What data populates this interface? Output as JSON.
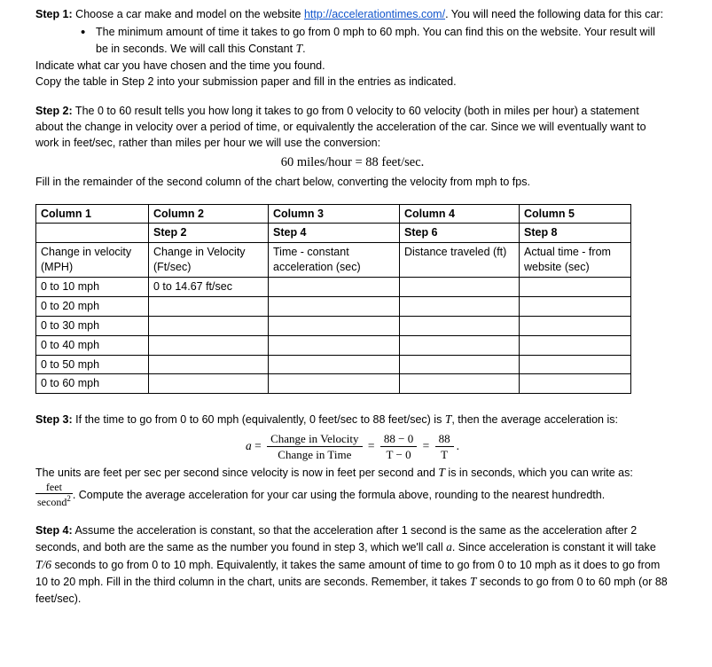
{
  "step1": {
    "label": "Step 1:",
    "text_before_link": " Choose a car make and model on the website ",
    "link": "http://accelerationtimes.com/",
    "text_after_link": ". You will need the following data for this car:",
    "bullet": "The minimum amount of time it takes to go from 0 mph to 60 mph. You can find this on the website. Your result will be in seconds. We will call this Constant ",
    "bullet_symbol": "T",
    "bullet_end": ".",
    "line2": "Indicate what car you have chosen and the time you found.",
    "line3": "Copy the table in Step 2 into your submission paper and fill in the entries as indicated."
  },
  "step2": {
    "label": "Step 2:",
    "text": " The 0 to 60 result tells you how long it takes to go from 0 velocity to 60 velocity (both in miles per hour) a statement about the change in velocity over a period of time, or equivalently the acceleration of the car.  Since we will eventually want to work in feet/sec, rather than miles per hour we will use the conversion:",
    "conversion": "60 miles/hour = 88 feet/sec.",
    "fill_line": "Fill in the remainder of the second column of the chart below, converting the velocity from mph to fps."
  },
  "table": {
    "headers": [
      "Column 1",
      "Column 2",
      "Column 3",
      "Column 4",
      "Column 5"
    ],
    "subheaders": [
      "",
      "Step 2",
      "Step 4",
      "Step 6",
      "Step 8"
    ],
    "descriptions": [
      "Change in velocity (MPH)",
      "Change in Velocity (Ft/sec)",
      "Time - constant acceleration (sec)",
      "Distance traveled (ft)",
      "Actual time - from website (sec)"
    ],
    "rows": [
      [
        "0 to 10 mph",
        "0 to 14.67 ft/sec",
        "",
        "",
        ""
      ],
      [
        "0 to 20 mph",
        "",
        "",
        "",
        ""
      ],
      [
        "0 to 30 mph",
        "",
        "",
        "",
        ""
      ],
      [
        "0 to 40 mph",
        "",
        "",
        "",
        ""
      ],
      [
        "0 to 50 mph",
        "",
        "",
        "",
        ""
      ],
      [
        "0 to 60 mph",
        "",
        "",
        "",
        ""
      ]
    ]
  },
  "step3": {
    "label": "Step 3:",
    "text": " If the time to go from 0 to 60 mph (equivalently, 0 feet/sec to 88 feet/sec) is ",
    "symbol_T": "T",
    "text2": ", then the average acceleration is:",
    "equation": {
      "a": "a",
      "equals": "=",
      "frac1_num": "Change in Velocity",
      "frac1_den": "Change in Time",
      "frac2_num": "88 − 0",
      "frac2_den": "T − 0",
      "frac3_num": "88",
      "frac3_den": "T",
      "period": "."
    },
    "units_text": "The units are feet per sec per second since velocity is now in feet per second and ",
    "units_text2": " is in seconds, which you can write as: ",
    "feet": "feet",
    "second": "second",
    "squared": "2",
    "compute": ". Compute the average acceleration for your car using the formula above, rounding to the nearest hundredth."
  },
  "step4": {
    "label": "Step 4:",
    "text_a": " Assume the acceleration is constant, so that the acceleration after 1 second is the same as the acceleration after 2 seconds, and both are the same as the number you found in step 3, which we'll call ",
    "symbol_a": "a",
    "text_b": ". Since acceleration is constant it will take ",
    "symbol_T6": "T/6",
    "text_c": " seconds to go from 0 to 10 mph. Equivalently, it takes the same amount of time to go from 0 to 10 mph as it does to go from 10 to 20 mph. Fill in the third column in the chart, units are seconds. Remember, it takes ",
    "symbol_T": "T",
    "text_d": " seconds to go from 0 to 60 mph (or 88 feet/sec)."
  }
}
